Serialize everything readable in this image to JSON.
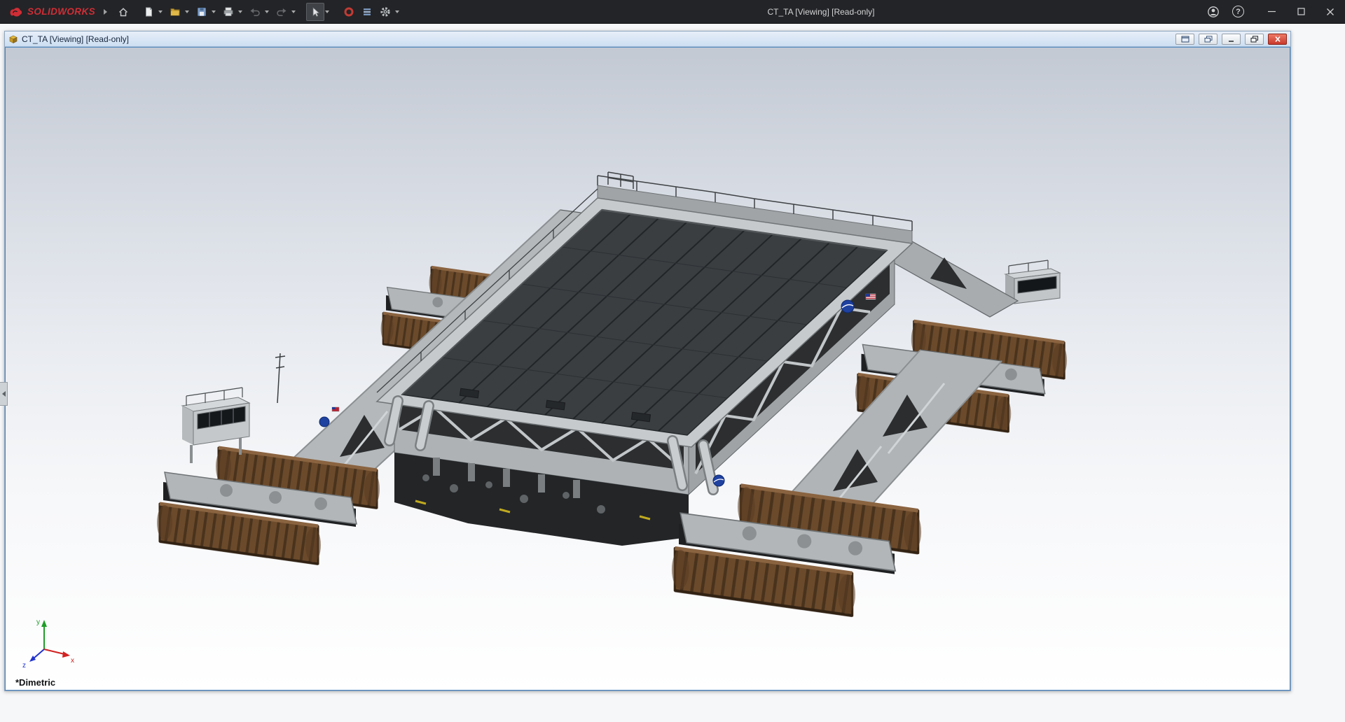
{
  "colors": {
    "titlebar_bg": "#232427",
    "accent_red": "#cf2e36",
    "toolbar_icon": "#c6c7c9",
    "doc_title_from": "#e7eef9",
    "doc_title_to": "#cddff2",
    "doc_border": "#4e86bd",
    "viewport_top": "#c3c9d3",
    "viewport_mid": "#e8ebf0",
    "viewport_bottom": "#ffffff",
    "track_brown": "#6b4a2b",
    "steel_light": "#c6cacc",
    "steel_mid": "#aeb2b4",
    "deck_dark": "#3a3e41",
    "nasa_blue": "#1f41a0",
    "close_red": "#d6453a"
  },
  "app_titlebar": {
    "brand_mark_icon": "ds-swirl",
    "brand_name": "SOLIDWORKS",
    "document_title": "CT_TA [Viewing] [Read-only]",
    "help_glyph": "?"
  },
  "toolbar_icons": {
    "home": "house",
    "new_document": "blank page",
    "open": "folder",
    "save": "floppy disk",
    "print": "printer",
    "undo": "curved arrow left (disabled)",
    "redo": "curved arrow right (disabled)",
    "select": "cursor arrow (active tool)",
    "mouse_gestures": "red ring",
    "display_pane": "list rows",
    "options": "gear"
  },
  "document_window": {
    "title": "CT_TA [Viewing] [Read-only]",
    "controls": {
      "tile": "window tile icon",
      "cascade": "window cascade icon",
      "minimize": "minimize",
      "restore": "restore",
      "close": "close"
    }
  },
  "viewport": {
    "orientation_label": "*Dimetric",
    "triad": {
      "x_label": "x",
      "y_label": "y",
      "z_label": "z"
    },
    "model_subject": "NASA crawler-transporter CAD model, dimetric view"
  }
}
